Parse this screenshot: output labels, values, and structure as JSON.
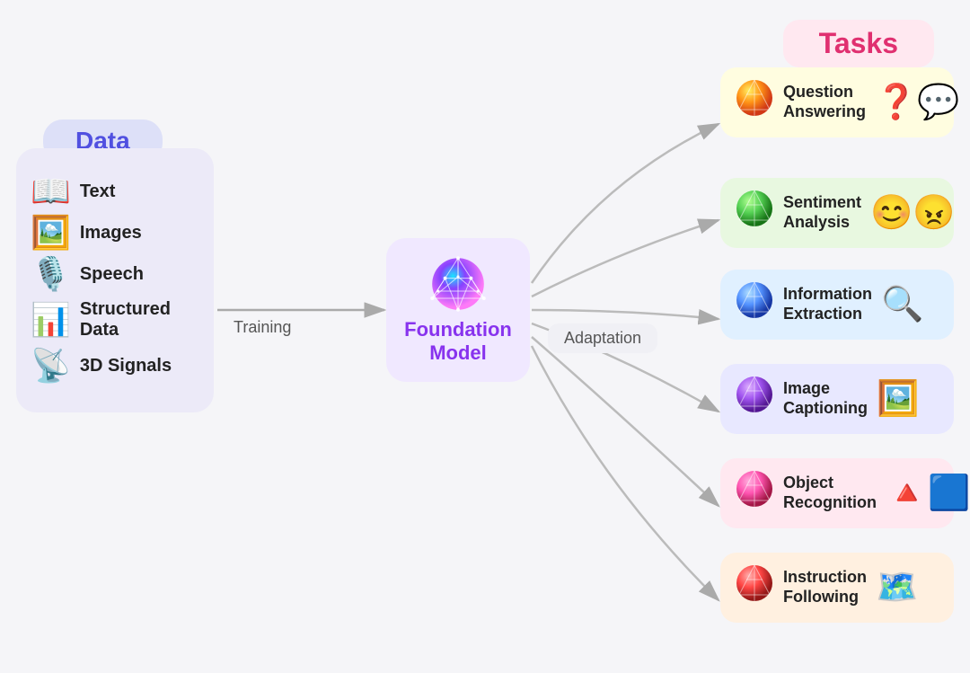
{
  "data_section": {
    "title": "Data",
    "items": [
      {
        "label": "Text",
        "icon": "📖"
      },
      {
        "label": "Images",
        "icon": "🖼️"
      },
      {
        "label": "Speech",
        "icon": "🎤"
      },
      {
        "label": "Structured Data",
        "icon": "📊"
      },
      {
        "label": "3D Signals",
        "icon": "📡"
      }
    ]
  },
  "foundation_model": {
    "title": "Foundation\nModel",
    "globe_icon": "🌐"
  },
  "labels": {
    "training": "Training",
    "adaptation": "Adaptation"
  },
  "tasks_section": {
    "title": "Tasks",
    "items": [
      {
        "label": "Question\nAnswering",
        "ball": "🟡",
        "icon": "❓"
      },
      {
        "label": "Sentiment\nAnalysis",
        "ball": "🟢",
        "icon": "😊"
      },
      {
        "label": "Information\nExtraction",
        "ball": "🔵",
        "icon": "🔍"
      },
      {
        "label": "Image\nCaptioning",
        "ball": "🟣",
        "icon": "🖼️"
      },
      {
        "label": "Object\nRecognition",
        "ball": "🔴",
        "icon": "🔺"
      },
      {
        "label": "Instruction\nFollowing",
        "ball": "🔴",
        "icon": "🗺️"
      }
    ]
  }
}
